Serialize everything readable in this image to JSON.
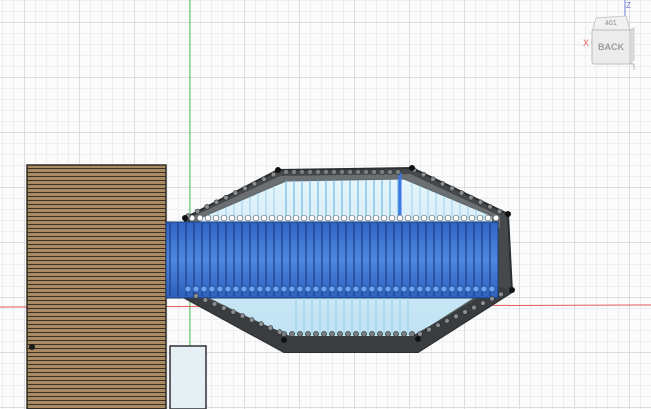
{
  "viewcube": {
    "face_label": "BACK",
    "top_label": "401",
    "x_axis_label": "X",
    "z_axis_label": "Z"
  },
  "colors": {
    "grid_major": "#d9dde2",
    "grid_minor": "#eceef1",
    "axis_green": "#52c45a",
    "axis_red": "#e05a5a",
    "body_dark": "#3f4244",
    "selected_blue": "#3b6fd1",
    "glass_cyan": "#cfe9f7",
    "wood": "#a98a63"
  }
}
